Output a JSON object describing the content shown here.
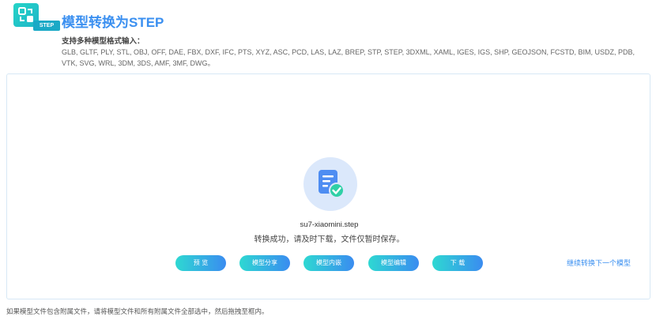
{
  "header": {
    "logo_badge": "STEP",
    "title": "模型转换为STEP"
  },
  "support": {
    "label": "支持多种模型格式输入：",
    "formats": "GLB, GLTF, PLY, STL, OBJ, OFF, DAE, FBX, DXF, IFC, PTS, XYZ, ASC, PCD, LAS, LAZ, BREP, STP, STEP, 3DXML, XAML, IGES, IGS, SHP, GEOJSON, FCSTD, BIM, USDZ, PDB, VTK, SVG, WRL, 3DM, 3DS, AMF, 3MF, DWG。"
  },
  "result": {
    "icon": "file-check-icon",
    "filename": "su7-xiaomini.step",
    "message": "转换成功，请及时下载，文件仅暂时保存。"
  },
  "actions": {
    "preview": "预 览",
    "share": "模型分享",
    "embed": "模型内嵌",
    "edit": "模型编辑",
    "download": "下 载",
    "next": "继续转换下一个模型"
  },
  "footnote": "如果模型文件包含附属文件，请将模型文件和所有附属文件全部选中，然后拖拽至框内。",
  "colors": {
    "accent": "#3a8ff0",
    "button_gradient_start": "#2ed8d2",
    "button_gradient_end": "#3a8cf0"
  }
}
